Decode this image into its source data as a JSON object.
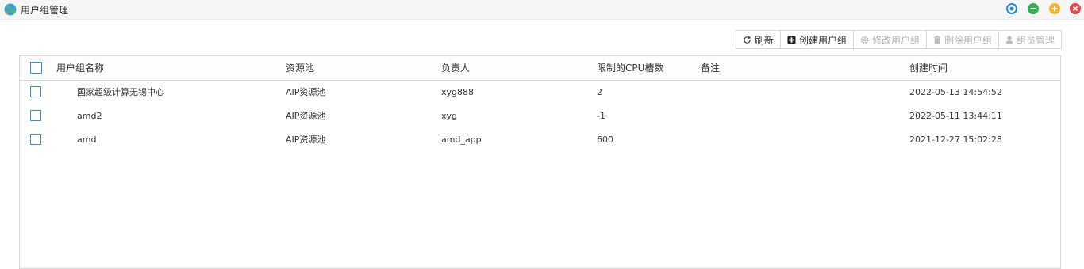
{
  "window": {
    "title": "用户组管理",
    "icons": [
      "app-globe-icon",
      "target-icon",
      "minimize-icon",
      "maximize-icon",
      "close-icon"
    ],
    "colors": {
      "target": "#1e88e5",
      "minimize": "#2bb24c",
      "maximize": "#f5b325",
      "close": "#e84545"
    }
  },
  "toolbar": {
    "buttons": [
      {
        "label": "刷新",
        "icon": "refresh-icon",
        "enabled": true
      },
      {
        "label": "创建用户组",
        "icon": "plus-square-icon",
        "enabled": true
      },
      {
        "label": "修改用户组",
        "icon": "gear-icon",
        "enabled": false
      },
      {
        "label": "删除用户组",
        "icon": "trash-icon",
        "enabled": false
      },
      {
        "label": "组员管理",
        "icon": "user-icon",
        "enabled": false
      }
    ]
  },
  "table": {
    "columns": [
      "用户组名称",
      "资源池",
      "负责人",
      "限制的CPU槽数",
      "备注",
      "创建时间"
    ],
    "rows": [
      {
        "name": "国家超级计算无锡中心",
        "pool": "AIP资源池",
        "owner": "xyg888",
        "cpu_slots": "2",
        "remark": "",
        "created": "2022-05-13 14:54:52"
      },
      {
        "name": "amd2",
        "pool": "AIP资源池",
        "owner": "xyg",
        "cpu_slots": "-1",
        "remark": "",
        "created": "2022-05-11 13:44:11"
      },
      {
        "name": "amd",
        "pool": "AIP资源池",
        "owner": "amd_app",
        "cpu_slots": "600",
        "remark": "",
        "created": "2021-12-27 15:02:28"
      }
    ]
  }
}
